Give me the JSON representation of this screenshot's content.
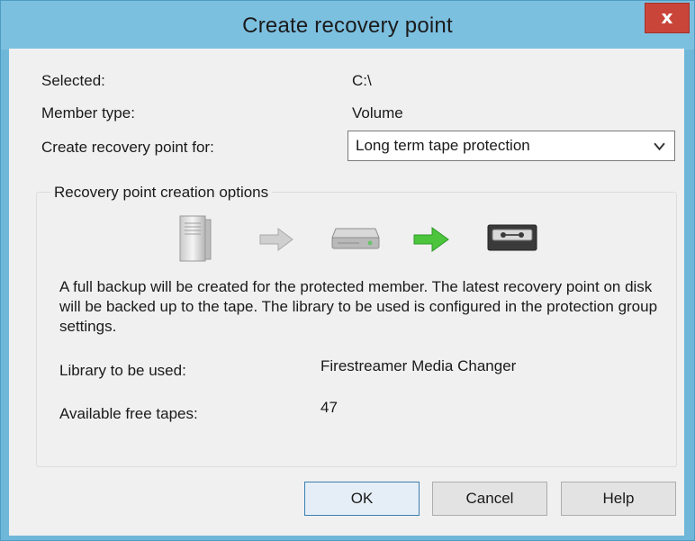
{
  "window": {
    "title": "Create recovery point",
    "close_label": "x"
  },
  "fields": {
    "selected_label": "Selected:",
    "selected_value": "C:\\",
    "member_type_label": "Member type:",
    "member_type_value": "Volume",
    "create_for_label": "Create recovery point for:",
    "create_for_value": "Long term tape protection"
  },
  "options_group": {
    "legend": "Recovery point creation options",
    "icons": [
      "server-icon",
      "arrow-right-gray-icon",
      "disk-icon",
      "arrow-right-green-icon",
      "tape-icon"
    ],
    "description": "A full backup will be created for the protected member. The latest recovery point on disk will be backed up to the tape. The library to be used is configured in the protection group settings.",
    "library_label": "Library to be used:",
    "library_value": "Firestreamer Media Changer",
    "free_tapes_label": "Available free tapes:",
    "free_tapes_value": "47"
  },
  "buttons": {
    "ok": "OK",
    "cancel": "Cancel",
    "help": "Help"
  },
  "colors": {
    "titlebar": "#7cc0e0",
    "close_button": "#c9453a",
    "client_bg": "#f0f0f0",
    "green_arrow": "#4cc43c"
  }
}
